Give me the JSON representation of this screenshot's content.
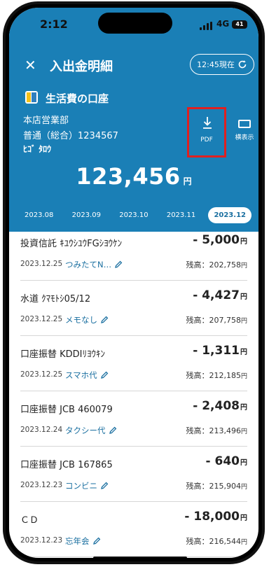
{
  "status_bar": {
    "time": "2:12",
    "network": "4G",
    "battery": "41"
  },
  "header": {
    "title": "入出金明細",
    "refresh_label": "12:45現在"
  },
  "account": {
    "name": "生活費の口座",
    "branch": "本店営業部",
    "type_number": "普通（総合）1234567",
    "holder": "ﾋｺﾞ ﾀﾛｳ",
    "balance": "123,456",
    "balance_unit": "円"
  },
  "actions": {
    "pdf_label": "PDF",
    "horizontal_label": "横表示"
  },
  "months": [
    "2023.08",
    "2023.09",
    "2023.10",
    "2023.11",
    "2023.12"
  ],
  "selected_month": "2023.12",
  "transactions": [
    {
      "desc": "投資信託 ｷﾕｳｼﾕｳFGｼﾖｳｹﾝ",
      "amount": "- 5,000",
      "date": "2023.12.25",
      "memo": "つみたてN…",
      "balance": "残高：202,758"
    },
    {
      "desc": "水道 ｸﾏﾓﾄｼ05/12",
      "amount": "- 4,427",
      "date": "2023.12.25",
      "memo": "メモなし",
      "balance": "残高：207,758"
    },
    {
      "desc": "口座振替 KDDIﾘﾖｳｷﾝ",
      "amount": "- 1,311",
      "date": "2023.12.25",
      "memo": "スマホ代",
      "balance": "残高：212,185"
    },
    {
      "desc": "口座振替 JCB 460079",
      "amount": "- 2,408",
      "date": "2023.12.24",
      "memo": "タクシー代",
      "balance": "残高：213,496"
    },
    {
      "desc": "口座振替 JCB 167865",
      "amount": "- 640",
      "date": "2023.12.23",
      "memo": "コンビニ",
      "balance": "残高：215,904"
    },
    {
      "desc": "ＣＤ",
      "amount": "- 18,000",
      "date": "2023.12.23",
      "memo": "忘年会",
      "balance": "残高：216,544"
    }
  ],
  "yen": "円",
  "colors": {
    "header_bg": "#1a7fb6",
    "accent": "#1a6fa0",
    "highlight": "#e02020"
  },
  "icons": {
    "close": "close-icon",
    "refresh": "refresh-icon",
    "pdf": "download-icon",
    "horizontal": "landscape-icon",
    "edit": "pencil-icon"
  }
}
